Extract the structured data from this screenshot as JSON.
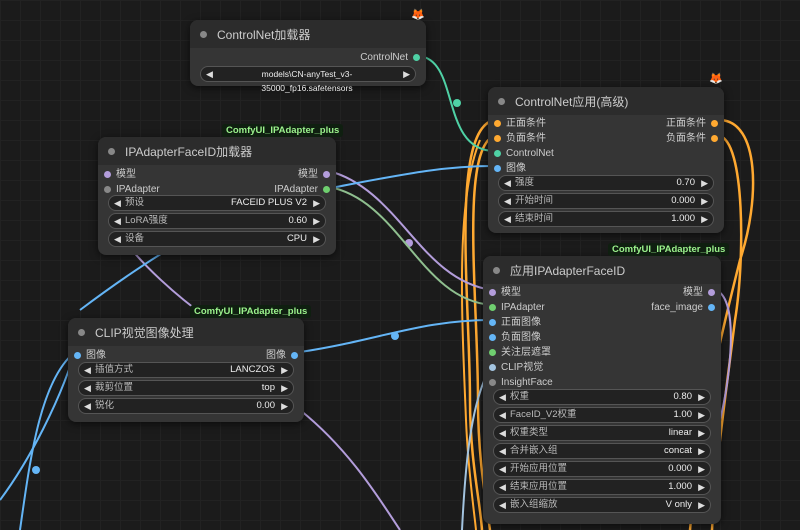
{
  "colors": {
    "model": "#b39ddb",
    "ipadapter": "#6fcf6f",
    "image": "#64b5f6",
    "conditioning": "#ffa931",
    "controlnet": "#4fd1a5",
    "clipvision": "#a3c4e0",
    "insightface": "#888888"
  },
  "badges": {
    "b1": "ComfyUI_IPAdapter_plus",
    "b2": "ComfyUI_IPAdapter_plus",
    "b3": "ComfyUI_IPAdapter_plus"
  },
  "controlnet_loader": {
    "title": "ControlNet加载器",
    "output": "ControlNet",
    "model_value": "models\\CN-anyTest_v3-35000_fp16.safetensors"
  },
  "controlnet_apply": {
    "title": "ControlNet应用(高级)",
    "inputs": [
      "正面条件",
      "负面条件",
      "ControlNet",
      "图像"
    ],
    "outputs": [
      "正面条件",
      "负面条件"
    ],
    "widgets": [
      {
        "label": "强度",
        "value": "0.70"
      },
      {
        "label": "开始时间",
        "value": "0.000"
      },
      {
        "label": "结束时间",
        "value": "1.000"
      }
    ]
  },
  "faceid_loader": {
    "title": "IPAdapterFaceID加载器",
    "inputs": [
      "模型",
      "IPAdapter"
    ],
    "outputs": [
      "模型",
      "IPAdapter"
    ],
    "widgets": [
      {
        "label": "预设",
        "value": "FACEID PLUS V2"
      },
      {
        "label": "LoRA强度",
        "value": "0.60"
      },
      {
        "label": "设备",
        "value": "CPU"
      }
    ]
  },
  "clip_process": {
    "title": "CLIP视觉图像处理",
    "input": "图像",
    "output": "图像",
    "widgets": [
      {
        "label": "插值方式",
        "value": "LANCZOS"
      },
      {
        "label": "裁剪位置",
        "value": "top"
      },
      {
        "label": "锐化",
        "value": "0.00"
      }
    ]
  },
  "faceid_apply": {
    "title": "应用IPAdapterFaceID",
    "inputs": [
      "模型",
      "IPAdapter",
      "正面图像",
      "负面图像",
      "关注层遮罩",
      "CLIP视觉",
      "InsightFace"
    ],
    "outputs": [
      "模型",
      "face_image"
    ],
    "widgets": [
      {
        "label": "权重",
        "value": "0.80"
      },
      {
        "label": "FaceID_V2权重",
        "value": "1.00"
      },
      {
        "label": "权重类型",
        "value": "linear"
      },
      {
        "label": "合并嵌入组",
        "value": "concat"
      },
      {
        "label": "开始应用位置",
        "value": "0.000"
      },
      {
        "label": "结束应用位置",
        "value": "1.000"
      },
      {
        "label": "嵌入组缩放",
        "value": "V only"
      }
    ]
  }
}
